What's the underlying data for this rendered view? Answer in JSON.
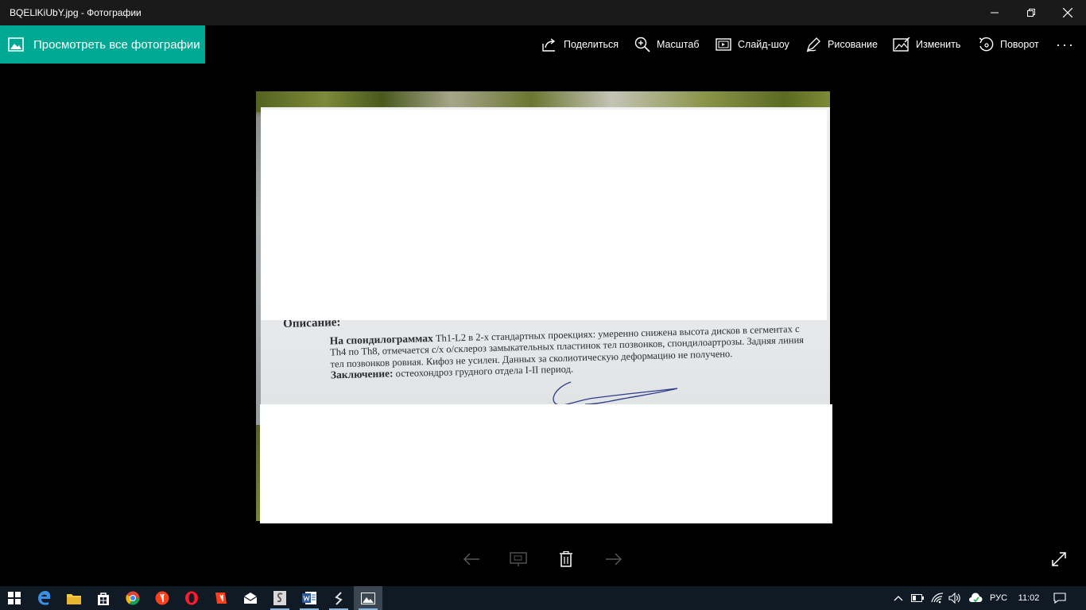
{
  "window": {
    "title": "BQELlKiUbY.jpg - Фотографии"
  },
  "toolbar": {
    "view_all_label": "Просмотреть все фотографии",
    "share_label": "Поделиться",
    "zoom_label": "Масштаб",
    "slideshow_label": "Слайд-шоу",
    "draw_label": "Рисование",
    "edit_label": "Изменить",
    "rotate_label": "Поворот",
    "more_label": "···"
  },
  "document": {
    "heading": "Описание:",
    "para1_bold": "На спондилограммах",
    "para1_text": " Th1-L2 в 2-х стандартных проекциях: умеренно снижена высота дисков в сегментах с Th4 по Th8, отмечается с/х о/склероз замыкательных пластинок тел позвонков, спондилоартрозы. Задняя линия тел позвонков ровная. Кифоз не усилен. Данных за сколиотическую деформацию не получено.",
    "conclusion_bold": "Заключение:",
    "conclusion_text": " остеохондроз грудного отдела I-II период."
  },
  "taskbar": {
    "language": "РУС",
    "time": "11:02",
    "apps": [
      "start-icon",
      "edge-icon",
      "explorer-icon",
      "store-icon",
      "chrome-icon",
      "yandex-icon",
      "opera-icon",
      "yandex-browser-icon",
      "mail-icon",
      "app-s-icon",
      "word-icon",
      "app-s2-icon",
      "photos-icon"
    ]
  },
  "colors": {
    "accent": "#00a994",
    "taskbar": "#0f1a24",
    "titlebar": "#1a1a1a"
  }
}
